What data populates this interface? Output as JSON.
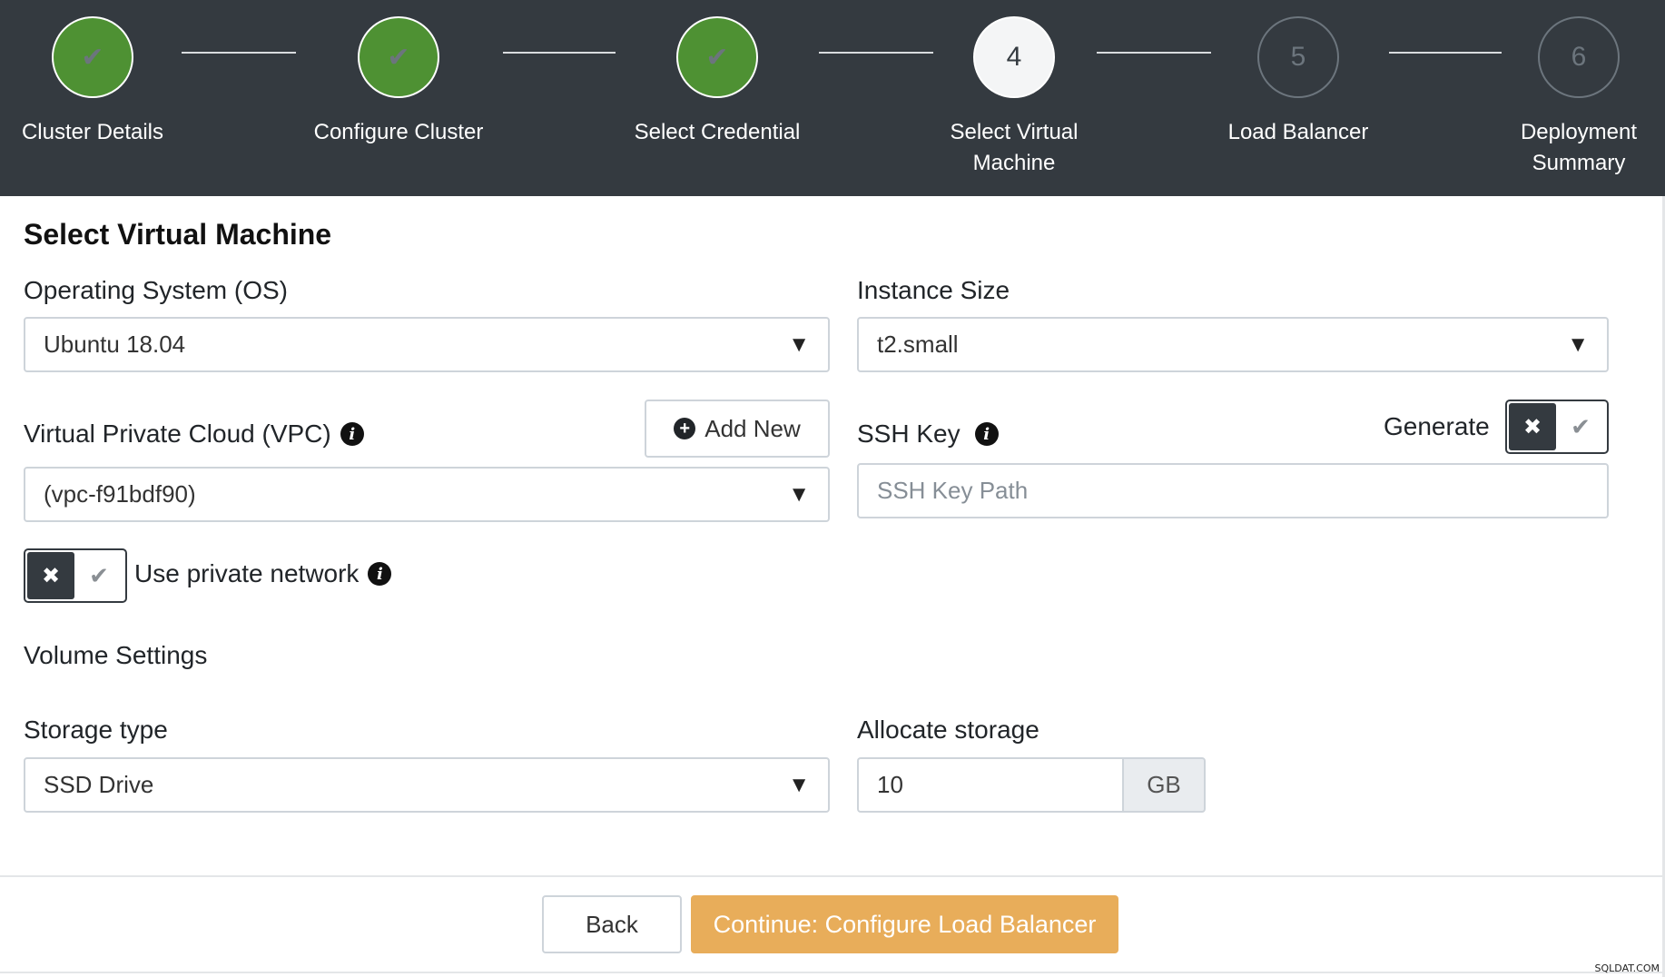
{
  "steps": [
    {
      "label": "Cluster Details",
      "status": "done",
      "marker": "✔"
    },
    {
      "label": "Configure Cluster",
      "status": "done",
      "marker": "✔"
    },
    {
      "label": "Select Credential",
      "status": "done",
      "marker": "✔"
    },
    {
      "label": "Select Virtual Machine",
      "status": "active",
      "marker": "4"
    },
    {
      "label": "Load Balancer",
      "status": "pending",
      "marker": "5"
    },
    {
      "label": "Deployment Summary",
      "status": "pending",
      "marker": "6"
    }
  ],
  "page": {
    "title": "Select Virtual Machine"
  },
  "os": {
    "label": "Operating System (OS)",
    "value": "Ubuntu 18.04"
  },
  "instance": {
    "label": "Instance Size",
    "value": "t2.small"
  },
  "vpc": {
    "label": "Virtual Private Cloud (VPC)",
    "value": "(vpc-f91bdf90)",
    "add_new_label": "Add New"
  },
  "ssh": {
    "label": "SSH Key",
    "generate_label": "Generate",
    "generate_enabled": false,
    "placeholder": "SSH Key Path"
  },
  "private_network": {
    "label": "Use private network",
    "enabled": false
  },
  "volume": {
    "section_title": "Volume Settings",
    "storage_type_label": "Storage type",
    "storage_type_value": "SSD Drive",
    "allocate_label": "Allocate storage",
    "allocate_value": "10",
    "allocate_unit": "GB"
  },
  "footer": {
    "back_label": "Back",
    "continue_label": "Continue: Configure Load Balancer"
  },
  "watermark": "SQLDAT.COM",
  "icons": {
    "check": "✔",
    "cross": "✖",
    "info": "i",
    "caret": "▼",
    "plus": "+"
  },
  "colors": {
    "header_bg": "#343a40",
    "done_green": "#4e9133",
    "continue_orange": "#e8ad5a"
  }
}
